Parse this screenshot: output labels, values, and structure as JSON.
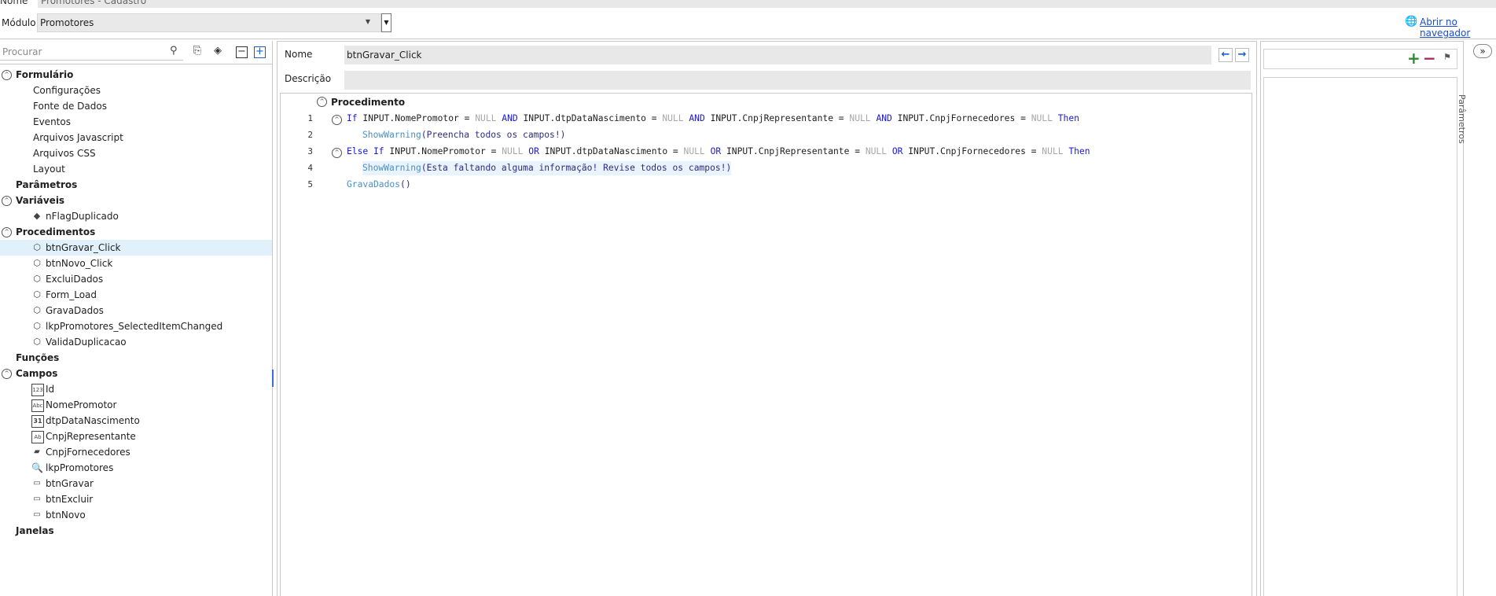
{
  "header": {
    "name_label": "Nome",
    "name_value": "Promotores - Cadastro",
    "module_label": "Módulo",
    "module_value": "Promotores",
    "browser_link": "Abrir no navegador"
  },
  "sidebar": {
    "search_placeholder": "Procurar",
    "sections": {
      "formulario": "Formulário",
      "formulario_items": [
        "Configurações",
        "Fonte de Dados",
        "Eventos",
        "Arquivos Javascript",
        "Arquivos CSS",
        "Layout"
      ],
      "parametros": "Parâmetros",
      "variaveis": "Variáveis",
      "variaveis_items": [
        "nFlagDuplicado"
      ],
      "procedimentos": "Procedimentos",
      "procedimentos_items": [
        "btnGravar_Click",
        "btnNovo_Click",
        "ExcluiDados",
        "Form_Load",
        "GravaDados",
        "lkpPromotores_SelectedItemChanged",
        "ValidaDuplicacao"
      ],
      "funcoes": "Funções",
      "campos": "Campos",
      "campos_items": [
        "Id",
        "NomePromotor",
        "dtpDataNascimento",
        "CnpjRepresentante",
        "CnpjFornecedores",
        "lkpPromotores",
        "btnGravar",
        "btnExcluir",
        "btnNovo"
      ],
      "janelas": "Janelas"
    }
  },
  "editor": {
    "name_label": "Nome",
    "name_value": "btnGravar_Click",
    "desc_label": "Descrição",
    "desc_value": "",
    "proc_header": "Procedimento",
    "line_numbers": [
      "1",
      "2",
      "3",
      "4",
      "5"
    ],
    "code": {
      "l1_if": "If",
      "l1_a": " INPUT.NomePromotor = ",
      "null": "NULL",
      "and": "AND",
      "or": "OR",
      "then": "Then",
      "l1_b": " INPUT.dtpDataNascimento = ",
      "l1_c": " INPUT.CnpjRepresentante = ",
      "l1_d": " INPUT.CnpjFornecedores = ",
      "l2_fn": "ShowWarning",
      "l2_arg": "(Preencha todos os campos!)",
      "l3_else": "Else If",
      "l4_arg": "(Esta faltando alguma informação! Revise todos os campos!)",
      "l5_fn": "GravaDados",
      "l5_arg": "()"
    }
  },
  "params": {
    "side_tab": "Parâmetros"
  },
  "icons": {
    "search": "search-icon",
    "add": "plus-icon",
    "remove": "minus-icon"
  },
  "colors": {
    "keyword": "#1a1ad0",
    "null": "#a8a8a8",
    "function": "#4d8fc4",
    "selection": "#e1f1fb"
  }
}
